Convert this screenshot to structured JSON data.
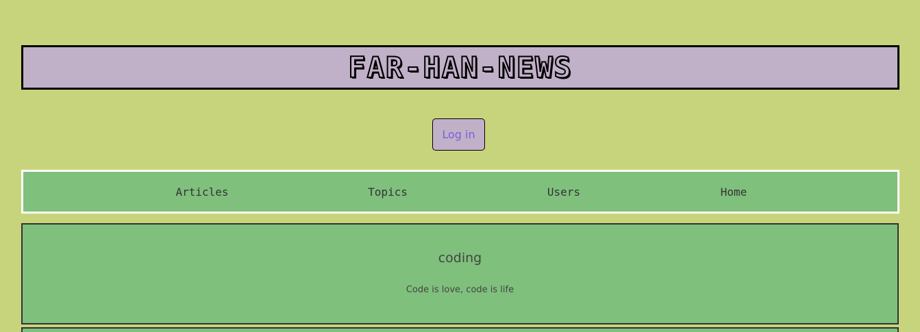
{
  "header": {
    "site_title": "FAR-HAN-NEWS"
  },
  "auth": {
    "login_label": "Log in"
  },
  "nav": {
    "items": [
      {
        "label": "Articles"
      },
      {
        "label": "Topics"
      },
      {
        "label": "Users"
      },
      {
        "label": "Home"
      }
    ]
  },
  "topics": [
    {
      "slug": "coding",
      "description": "Code is love, code is life"
    }
  ],
  "colors": {
    "page_background": "#c8d47c",
    "title_bar": "#c0b0c8",
    "nav_background": "#7fc07c",
    "card_background": "#7fc07c",
    "login_text": "#7a5ee0"
  }
}
